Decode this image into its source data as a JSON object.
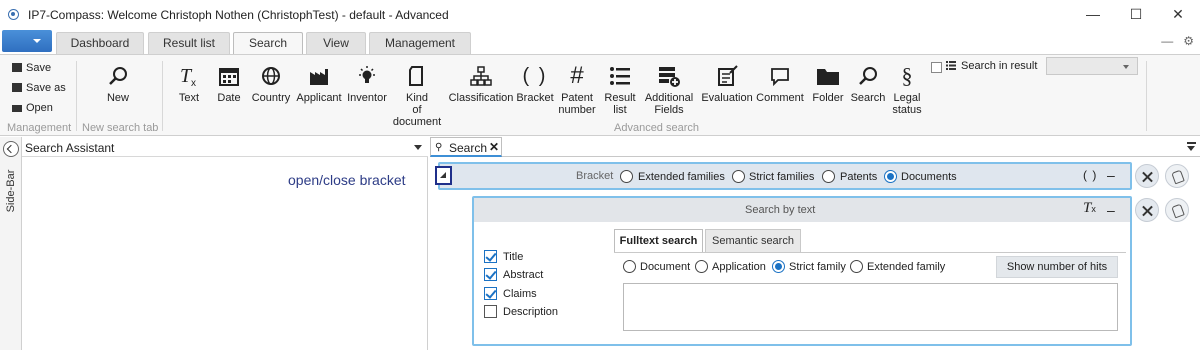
{
  "window": {
    "title": "IP7-Compass: Welcome Christoph Nothen (ChristophTest) - default - Advanced",
    "minimize": "—",
    "maximize": "☐",
    "close": "✕"
  },
  "tabs": [
    {
      "label": "Dashboard"
    },
    {
      "label": "Result list"
    },
    {
      "label": "Search",
      "active": true
    },
    {
      "label": "View"
    },
    {
      "label": "Management"
    }
  ],
  "tabbar_right": {
    "minimize": "—",
    "settings": "⚙"
  },
  "ribbon": {
    "management": {
      "save": "Save",
      "save_as": "Save as",
      "open": "Open",
      "group_label": "Management"
    },
    "new_search": {
      "new": "New",
      "group_label": "New search tab"
    },
    "advanced": {
      "group_label": "Advanced search",
      "items": [
        {
          "label": "Text",
          "icon": "text-clear-icon"
        },
        {
          "label": "Date",
          "icon": "calendar-icon"
        },
        {
          "label": "Country",
          "icon": "globe-icon"
        },
        {
          "label": "Applicant",
          "icon": "factory-icon"
        },
        {
          "label": "Inventor",
          "icon": "lightbulb-icon"
        },
        {
          "label": "Kind of document",
          "icon": "document-icon"
        },
        {
          "label": "Classification",
          "icon": "hierarchy-icon"
        },
        {
          "label": "Bracket",
          "icon": "bracket-icon"
        },
        {
          "label": "Patent number",
          "icon": "hash-icon"
        },
        {
          "label": "Result list",
          "icon": "list-icon"
        },
        {
          "label": "Additional Fields",
          "icon": "add-fields-icon"
        },
        {
          "label": "Evaluation",
          "icon": "evaluation-icon"
        },
        {
          "label": "Comment",
          "icon": "comment-icon"
        },
        {
          "label": "Folder",
          "icon": "folder-icon"
        },
        {
          "label": "Search",
          "icon": "search-icon"
        },
        {
          "label": "Legal status",
          "icon": "paragraph-icon"
        }
      ]
    },
    "search_in_result": {
      "label": "Search in result",
      "checked": false,
      "selected": ""
    }
  },
  "sidebar": {
    "label": "Side-Bar"
  },
  "assistant": {
    "title": "Search Assistant"
  },
  "annotation": "open/close bracket",
  "doc_tab": {
    "label": "Search",
    "close": "✕"
  },
  "bracket": {
    "label": "Bracket",
    "options": [
      {
        "label": "Extended families",
        "selected": false
      },
      {
        "label": "Strict families",
        "selected": false
      },
      {
        "label": "Patents",
        "selected": false
      },
      {
        "label": "Documents",
        "selected": true
      }
    ],
    "paren": "( )",
    "minus": "–"
  },
  "search_by_text": {
    "title": "Search by text",
    "clear": "T",
    "minus": "–",
    "fields": [
      {
        "label": "Title",
        "checked": true
      },
      {
        "label": "Abstract",
        "checked": true
      },
      {
        "label": "Claims",
        "checked": true
      },
      {
        "label": "Description",
        "checked": false
      }
    ],
    "tabs": [
      {
        "label": "Fulltext search",
        "active": true
      },
      {
        "label": "Semantic search",
        "active": false
      }
    ],
    "scope_options": [
      {
        "label": "Document",
        "selected": false
      },
      {
        "label": "Application",
        "selected": false
      },
      {
        "label": "Strict family",
        "selected": true
      },
      {
        "label": "Extended family",
        "selected": false
      }
    ],
    "hits_button": "Show number of hits",
    "query_value": ""
  }
}
